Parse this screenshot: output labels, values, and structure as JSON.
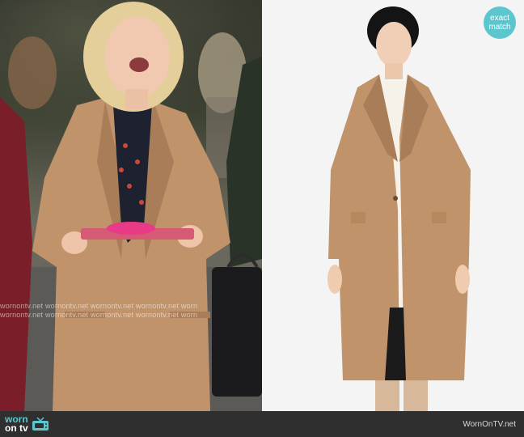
{
  "badge": {
    "line1": "exact",
    "line2": "match"
  },
  "watermark": {
    "row1": "wornontv.net wornontv.net wornontv.net wornontv.net worn",
    "row2": "wornontv.net wornontv.net wornontv.net wornontv.net worn"
  },
  "footer": {
    "logo_line1": "worn",
    "logo_line2": "on tv",
    "site_label": "WornOnTV.net"
  },
  "colors": {
    "accent": "#5cc6cf",
    "coat": "#c0936a",
    "footer_bg": "#2f2f2f"
  },
  "icons": {
    "logo": "tv-icon"
  }
}
